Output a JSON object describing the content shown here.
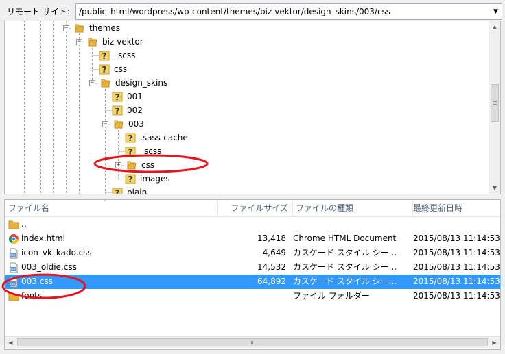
{
  "address_bar": {
    "label": "リモート サイト:",
    "path": "/public_html/wordpress/wp-content/themes/biz-vektor/design_skins/003/css"
  },
  "tree": [
    {
      "label": "themes",
      "icon": "folder-open",
      "expander": "minus"
    },
    {
      "label": "biz-vektor",
      "icon": "folder-open",
      "expander": "minus"
    },
    {
      "label": "_scss",
      "icon": "question-folder",
      "expander": "none"
    },
    {
      "label": "css",
      "icon": "question-folder",
      "expander": "none"
    },
    {
      "label": "design_skins",
      "icon": "folder-open",
      "expander": "minus"
    },
    {
      "label": "001",
      "icon": "question-folder",
      "expander": "none"
    },
    {
      "label": "002",
      "icon": "question-folder",
      "expander": "none"
    },
    {
      "label": "003",
      "icon": "folder-open",
      "expander": "minus"
    },
    {
      "label": ".sass-cache",
      "icon": "question-folder",
      "expander": "none"
    },
    {
      "label": "_scss",
      "icon": "question-folder",
      "expander": "none"
    },
    {
      "label": "css",
      "icon": "folder-open",
      "expander": "plus"
    },
    {
      "label": "images",
      "icon": "question-folder",
      "expander": "none"
    },
    {
      "label": "plain",
      "icon": "question-folder",
      "expander": "none"
    }
  ],
  "file_list": {
    "columns": [
      "ファイル名",
      "ファイルサイズ",
      "ファイルの種類",
      "最終更新日時"
    ],
    "rows": [
      {
        "name": "..",
        "size": "",
        "type": "",
        "modified": "",
        "icon": "folder"
      },
      {
        "name": "index.html",
        "size": "13,418",
        "type": "Chrome HTML Document",
        "modified": "2015/08/13 11:14:53",
        "icon": "chrome"
      },
      {
        "name": "icon_vk_kado.css",
        "size": "4,649",
        "type": "カスケード スタイル シー...",
        "modified": "2015/08/13 11:14:53",
        "icon": "css-file"
      },
      {
        "name": "003_oldie.css",
        "size": "14,532",
        "type": "カスケード スタイル シー...",
        "modified": "2015/08/13 11:14:53",
        "icon": "css-file"
      },
      {
        "name": "003.css",
        "size": "64,892",
        "type": "カスケード スタイル シー...",
        "modified": "2015/08/13 11:14:53",
        "icon": "css-file",
        "selected": true
      },
      {
        "name": "fonts",
        "size": "",
        "type": "ファイル フォルダー",
        "modified": "2015/08/13 11:14:53",
        "icon": "folder"
      }
    ]
  },
  "colors": {
    "selection": "#3399ff",
    "annotation": "#e8131b",
    "folder": "#e8b33a",
    "header_text": "#4c607a"
  }
}
